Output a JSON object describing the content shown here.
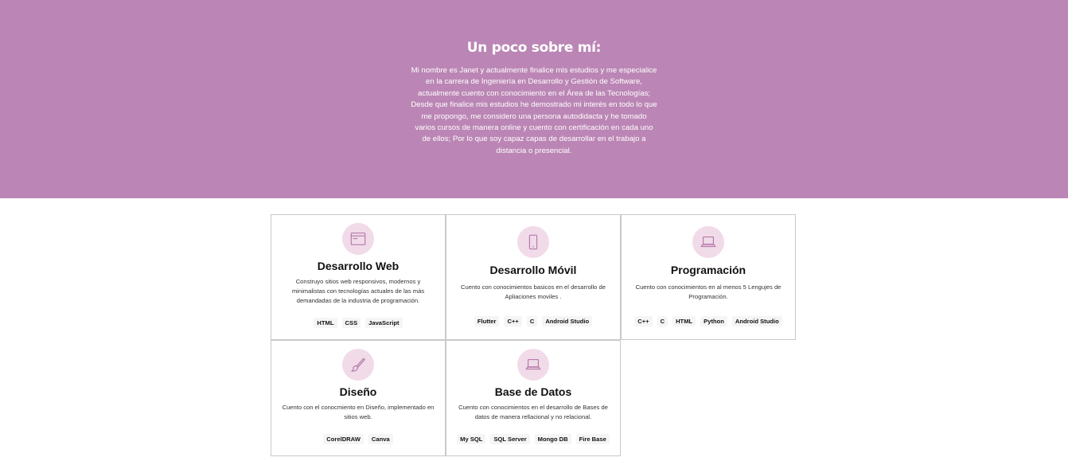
{
  "about": {
    "title": "Un poco sobre mí:",
    "text": "Mi nombre es Janet y actualmente finalice mis estudios y me especialice en la carrera de Ingeniería en Desarrollo y Gestión de Software, actualmente cuento con conocimiento en el Área de las Tecnologías; Desde que finalice mis estudios he demostrado mi interés en todo lo que me propongo, me considero una persona autodidacta y he tomado varios cursos de manera online y cuento con certificación en cada uno de ellos; Por lo que soy capaz capas de desarrollar en el trabajo a distancia o presencial."
  },
  "colors": {
    "banner": "#bb86b5",
    "icon_bg": "#f1dbe9",
    "icon_stroke": "#b779ad"
  },
  "cards": [
    {
      "icon": "browser-window-icon",
      "title": "Desarrollo Web",
      "desc": "Construyo sitios web responsivos, modernos y minimalistas con tecnologías actuales de las más demandadas de la industria de programación.",
      "tags": [
        "HTML",
        "CSS",
        "JavaScript"
      ]
    },
    {
      "icon": "smartphone-icon",
      "title": "Desarrollo Móvil",
      "desc": "Cuento con conocimientos basicos en el desarrollo de Apliaciones moviles .",
      "tags": [
        "Flutter",
        "C++",
        "C",
        "Android Studio"
      ]
    },
    {
      "icon": "laptop-icon",
      "title": "Programación",
      "desc": "Cuento con conocimientos en al menos 5 Lengujes de Programación.",
      "tags": [
        "C++",
        "C",
        "HTML",
        "Python",
        "Android Studio"
      ]
    },
    {
      "icon": "paintbrush-icon",
      "title": "Diseño",
      "desc": "Cuento con el conocmiento en Diseño, implementado en sitios web.",
      "tags": [
        "CorelDRAW",
        "Canva"
      ]
    },
    {
      "icon": "laptop-icon",
      "title": "Base de Datos",
      "desc": "Cuento con conocimientos en el desarrollo de Bases de datos de manera rellacional y no relacional.",
      "tags": [
        "My SQL",
        "SQL Server",
        "Mongo DB",
        "Fire Base"
      ]
    }
  ]
}
